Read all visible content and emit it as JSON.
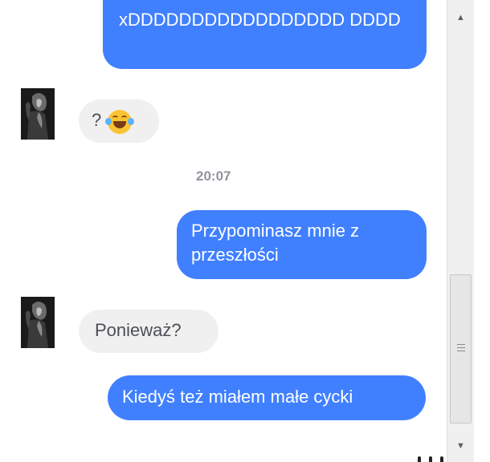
{
  "messages": [
    {
      "id": "msg1",
      "direction": "outgoing",
      "text": "xDDDDDDDDDDDDDDDDD DDDD"
    },
    {
      "id": "msg2",
      "direction": "incoming",
      "text": "?",
      "emoji": "face-with-tears-of-joy-icon"
    },
    {
      "id": "msg3",
      "direction": "outgoing",
      "text": "Przypominasz mnie z przeszłości"
    },
    {
      "id": "msg4",
      "direction": "incoming",
      "text": "Ponieważ?"
    },
    {
      "id": "msg5",
      "direction": "outgoing",
      "text": "Kiedyś też miałem małe cycki"
    }
  ],
  "timestamp": "20:07",
  "colors": {
    "outgoing_bubble": "#4080ff",
    "incoming_bubble": "#f1f0f0",
    "timestamp_text": "#90949c"
  },
  "icons": {
    "scroll_up": "caret-up-icon",
    "scroll_down": "caret-down-icon",
    "scroll_grip": "grip-lines-icon"
  }
}
